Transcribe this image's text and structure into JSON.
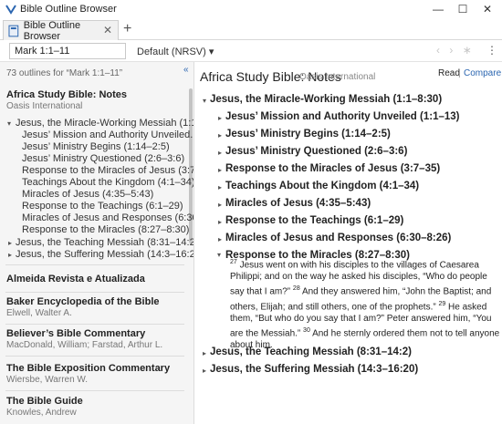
{
  "window": {
    "title": "Bible Outline Browser",
    "min_glyph": "—",
    "max_glyph": "☐",
    "close_glyph": "✕"
  },
  "tabs": [
    {
      "label": "Bible Outline Browser",
      "icon": "book-icon"
    }
  ],
  "toolbar": {
    "reference": "Mark 1:1–11",
    "version": "Default (NRSV)"
  },
  "sidebar": {
    "count_text": "73 outlines for “Mark 1:1–11”",
    "entries": [
      {
        "title": "Africa Study Bible: Notes",
        "subtitle": "Oasis International",
        "selected": true,
        "tree": {
          "label": "Jesus, the Miracle-Working Messiah (1:1...",
          "children": [
            "Jesus’ Mission and Authority Unveiled...",
            "Jesus’ Ministry Begins (1:14–2:5)",
            "Jesus’ Ministry Questioned (2:6–3:6)",
            "Response to the Miracles of Jesus (3:7...",
            "Teachings About the Kingdom (4:1–34)",
            "Miracles of Jesus (4:35–5:43)",
            "Response to the Teachings (6:1–29)",
            "Miracles of Jesus and Responses (6:30...",
            "Response to the Miracles (8:27–8:30)"
          ]
        },
        "more_items": [
          "Jesus, the Teaching Messiah (8:31–14:2)",
          "Jesus, the Suffering Messiah (14:3–16:20)"
        ]
      },
      {
        "title": "Almeida Revista e Atualizada",
        "subtitle": ""
      },
      {
        "title": "Baker Encyclopedia of the Bible",
        "subtitle": "Elwell, Walter A."
      },
      {
        "title": "Believer’s Bible Commentary",
        "subtitle": "MacDonald, William; Farstad, Arthur L."
      },
      {
        "title": "The Bible Exposition Commentary",
        "subtitle": "Wiersbe, Warren W."
      },
      {
        "title": "The Bible Guide",
        "subtitle": "Knowles, Andrew"
      }
    ]
  },
  "main": {
    "title": "Africa Study Bible: Notes",
    "publisher": "Oasis International",
    "read_label": "Read",
    "separator": "|",
    "compare_label": "Compare",
    "outline": {
      "top": "Jesus, the Miracle-Working Messiah (1:1–8:30)",
      "children": [
        "Jesus’ Mission and Authority Unveiled (1:1–13)",
        "Jesus’ Ministry Begins (1:14–2:5)",
        "Jesus’ Ministry Questioned (2:6–3:6)",
        "Response to the Miracles of Jesus (3:7–35)",
        "Teachings About the Kingdom (4:1–34)",
        "Miracles of Jesus (4:35–5:43)",
        "Response to the Teachings (6:1–29)",
        "Miracles of Jesus and Responses (6:30–8:26)",
        "Response to the Miracles (8:27–8:30)"
      ],
      "tail": [
        "Jesus, the Teaching Messiah (8:31–14:2)",
        "Jesus, the Suffering Messiah (14:3–16:20)"
      ]
    },
    "passage": {
      "v27_num": "27",
      "v27": " Jesus went on with his disciples to the villages of Caesarea Philippi; and on the way he asked his disciples, “Who do people say that I am?” ",
      "v28_num": "28",
      "v28": " And they answered him, “John the Baptist; and others, Elijah; and still others, one of the prophets.” ",
      "v29_num": "29",
      "v29": " He asked them, “But who do you say that I am?” Peter answered him, “You are the Messiah.” ",
      "v30_num": "30",
      "v30": " And he sternly ordered them not to tell anyone about him."
    }
  },
  "colors": {
    "accent": "#2a65b0",
    "sidebar_bg": "#f5f5f5",
    "muted_text": "#777777"
  }
}
